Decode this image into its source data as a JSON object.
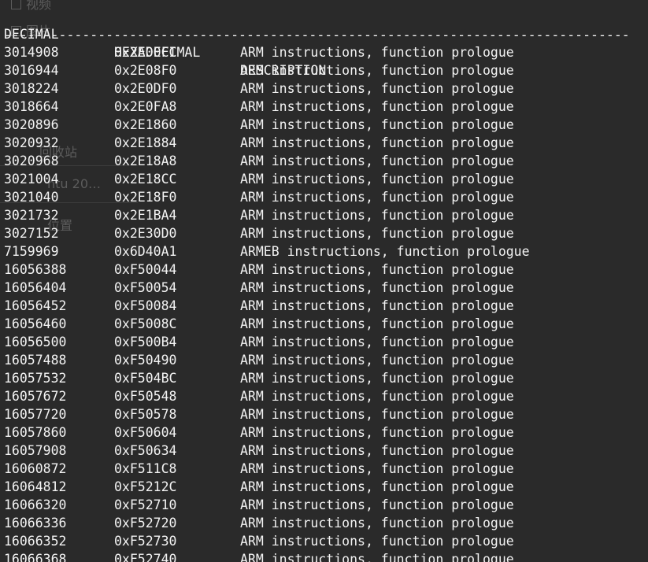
{
  "ghost": {
    "items": [
      "视频",
      "图片",
      "回收站",
      "ntu 20…",
      "位置"
    ]
  },
  "columns": {
    "decimal": "DECIMAL",
    "hexadecimal": "HEXADECIMAL",
    "description": "DESCRIPTION"
  },
  "rule": "--------------------------------------------------------------------------------",
  "rows": [
    {
      "dec": "3014908",
      "hex": "0x2E00FC",
      "desc": "ARM instructions, function prologue"
    },
    {
      "dec": "3016944",
      "hex": "0x2E08F0",
      "desc": "ARM instructions, function prologue"
    },
    {
      "dec": "3018224",
      "hex": "0x2E0DF0",
      "desc": "ARM instructions, function prologue"
    },
    {
      "dec": "3018664",
      "hex": "0x2E0FA8",
      "desc": "ARM instructions, function prologue"
    },
    {
      "dec": "3020896",
      "hex": "0x2E1860",
      "desc": "ARM instructions, function prologue"
    },
    {
      "dec": "3020932",
      "hex": "0x2E1884",
      "desc": "ARM instructions, function prologue"
    },
    {
      "dec": "3020968",
      "hex": "0x2E18A8",
      "desc": "ARM instructions, function prologue"
    },
    {
      "dec": "3021004",
      "hex": "0x2E18CC",
      "desc": "ARM instructions, function prologue"
    },
    {
      "dec": "3021040",
      "hex": "0x2E18F0",
      "desc": "ARM instructions, function prologue"
    },
    {
      "dec": "3021732",
      "hex": "0x2E1BA4",
      "desc": "ARM instructions, function prologue"
    },
    {
      "dec": "3027152",
      "hex": "0x2E30D0",
      "desc": "ARM instructions, function prologue"
    },
    {
      "dec": "7159969",
      "hex": "0x6D40A1",
      "desc": "ARMEB instructions, function prologue"
    },
    {
      "dec": "16056388",
      "hex": "0xF50044",
      "desc": "ARM instructions, function prologue"
    },
    {
      "dec": "16056404",
      "hex": "0xF50054",
      "desc": "ARM instructions, function prologue"
    },
    {
      "dec": "16056452",
      "hex": "0xF50084",
      "desc": "ARM instructions, function prologue"
    },
    {
      "dec": "16056460",
      "hex": "0xF5008C",
      "desc": "ARM instructions, function prologue"
    },
    {
      "dec": "16056500",
      "hex": "0xF500B4",
      "desc": "ARM instructions, function prologue"
    },
    {
      "dec": "16057488",
      "hex": "0xF50490",
      "desc": "ARM instructions, function prologue"
    },
    {
      "dec": "16057532",
      "hex": "0xF504BC",
      "desc": "ARM instructions, function prologue"
    },
    {
      "dec": "16057672",
      "hex": "0xF50548",
      "desc": "ARM instructions, function prologue"
    },
    {
      "dec": "16057720",
      "hex": "0xF50578",
      "desc": "ARM instructions, function prologue"
    },
    {
      "dec": "16057860",
      "hex": "0xF50604",
      "desc": "ARM instructions, function prologue"
    },
    {
      "dec": "16057908",
      "hex": "0xF50634",
      "desc": "ARM instructions, function prologue"
    },
    {
      "dec": "16060872",
      "hex": "0xF511C8",
      "desc": "ARM instructions, function prologue"
    },
    {
      "dec": "16064812",
      "hex": "0xF5212C",
      "desc": "ARM instructions, function prologue"
    },
    {
      "dec": "16066320",
      "hex": "0xF52710",
      "desc": "ARM instructions, function prologue"
    },
    {
      "dec": "16066336",
      "hex": "0xF52720",
      "desc": "ARM instructions, function prologue"
    },
    {
      "dec": "16066352",
      "hex": "0xF52730",
      "desc": "ARM instructions, function prologue"
    },
    {
      "dec": "16066368",
      "hex": "0xF52740",
      "desc": "ARM instructions, function prologue"
    }
  ],
  "colors": {
    "background": "#2a2a2a",
    "foreground": "#f3f3f3"
  }
}
